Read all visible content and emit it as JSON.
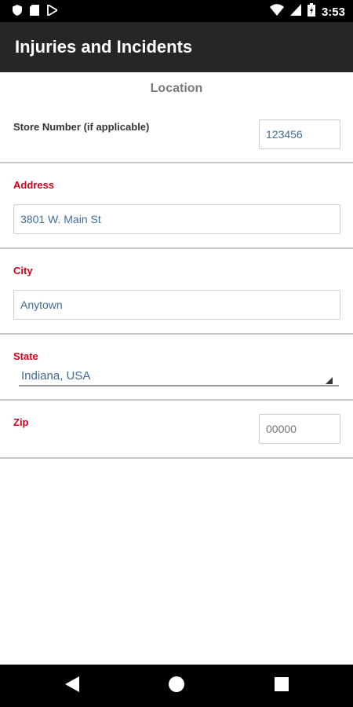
{
  "status_bar": {
    "time": "3:53",
    "icons": [
      "shield-icon",
      "sd-card-icon",
      "play-store-icon",
      "wifi-icon",
      "signal-icon",
      "battery-icon"
    ]
  },
  "app_bar": {
    "title": "Injuries and Incidents"
  },
  "form": {
    "section_title": "Location",
    "store_number": {
      "label": "Store Number (if applicable)",
      "value": "123456"
    },
    "address": {
      "label": "Address",
      "value": "3801 W. Main St"
    },
    "city": {
      "label": "City",
      "value": "Anytown"
    },
    "state": {
      "label": "State",
      "value": "Indiana, USA"
    },
    "zip": {
      "label": "Zip",
      "placeholder": "00000"
    }
  },
  "colors": {
    "required_label": "#d0021b",
    "input_text": "#3f6c98",
    "app_bar": "#262626"
  },
  "nav_bar": {
    "icons": [
      "back-icon",
      "home-icon",
      "recents-icon"
    ]
  }
}
